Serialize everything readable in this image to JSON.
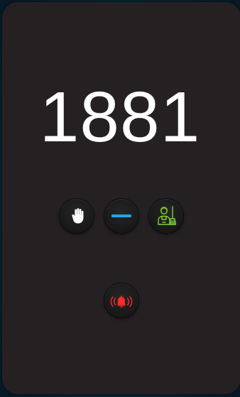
{
  "room": {
    "number": "1881"
  },
  "controls": {
    "dnd": {
      "icon": "hand-stop-icon",
      "color": "#ffffff"
    },
    "neutral": {
      "icon": "minus-bar-icon",
      "color": "#1aa7e8"
    },
    "clean": {
      "icon": "housekeeping-cleaner-icon",
      "color": "#7fd13b"
    },
    "alarm": {
      "icon": "alarm-bell-ringing-icon",
      "color": "#ff2a2a"
    }
  },
  "colors": {
    "panel_bg": "#252022",
    "text": "#ffffff",
    "button_bg": "#1c1c1c"
  }
}
